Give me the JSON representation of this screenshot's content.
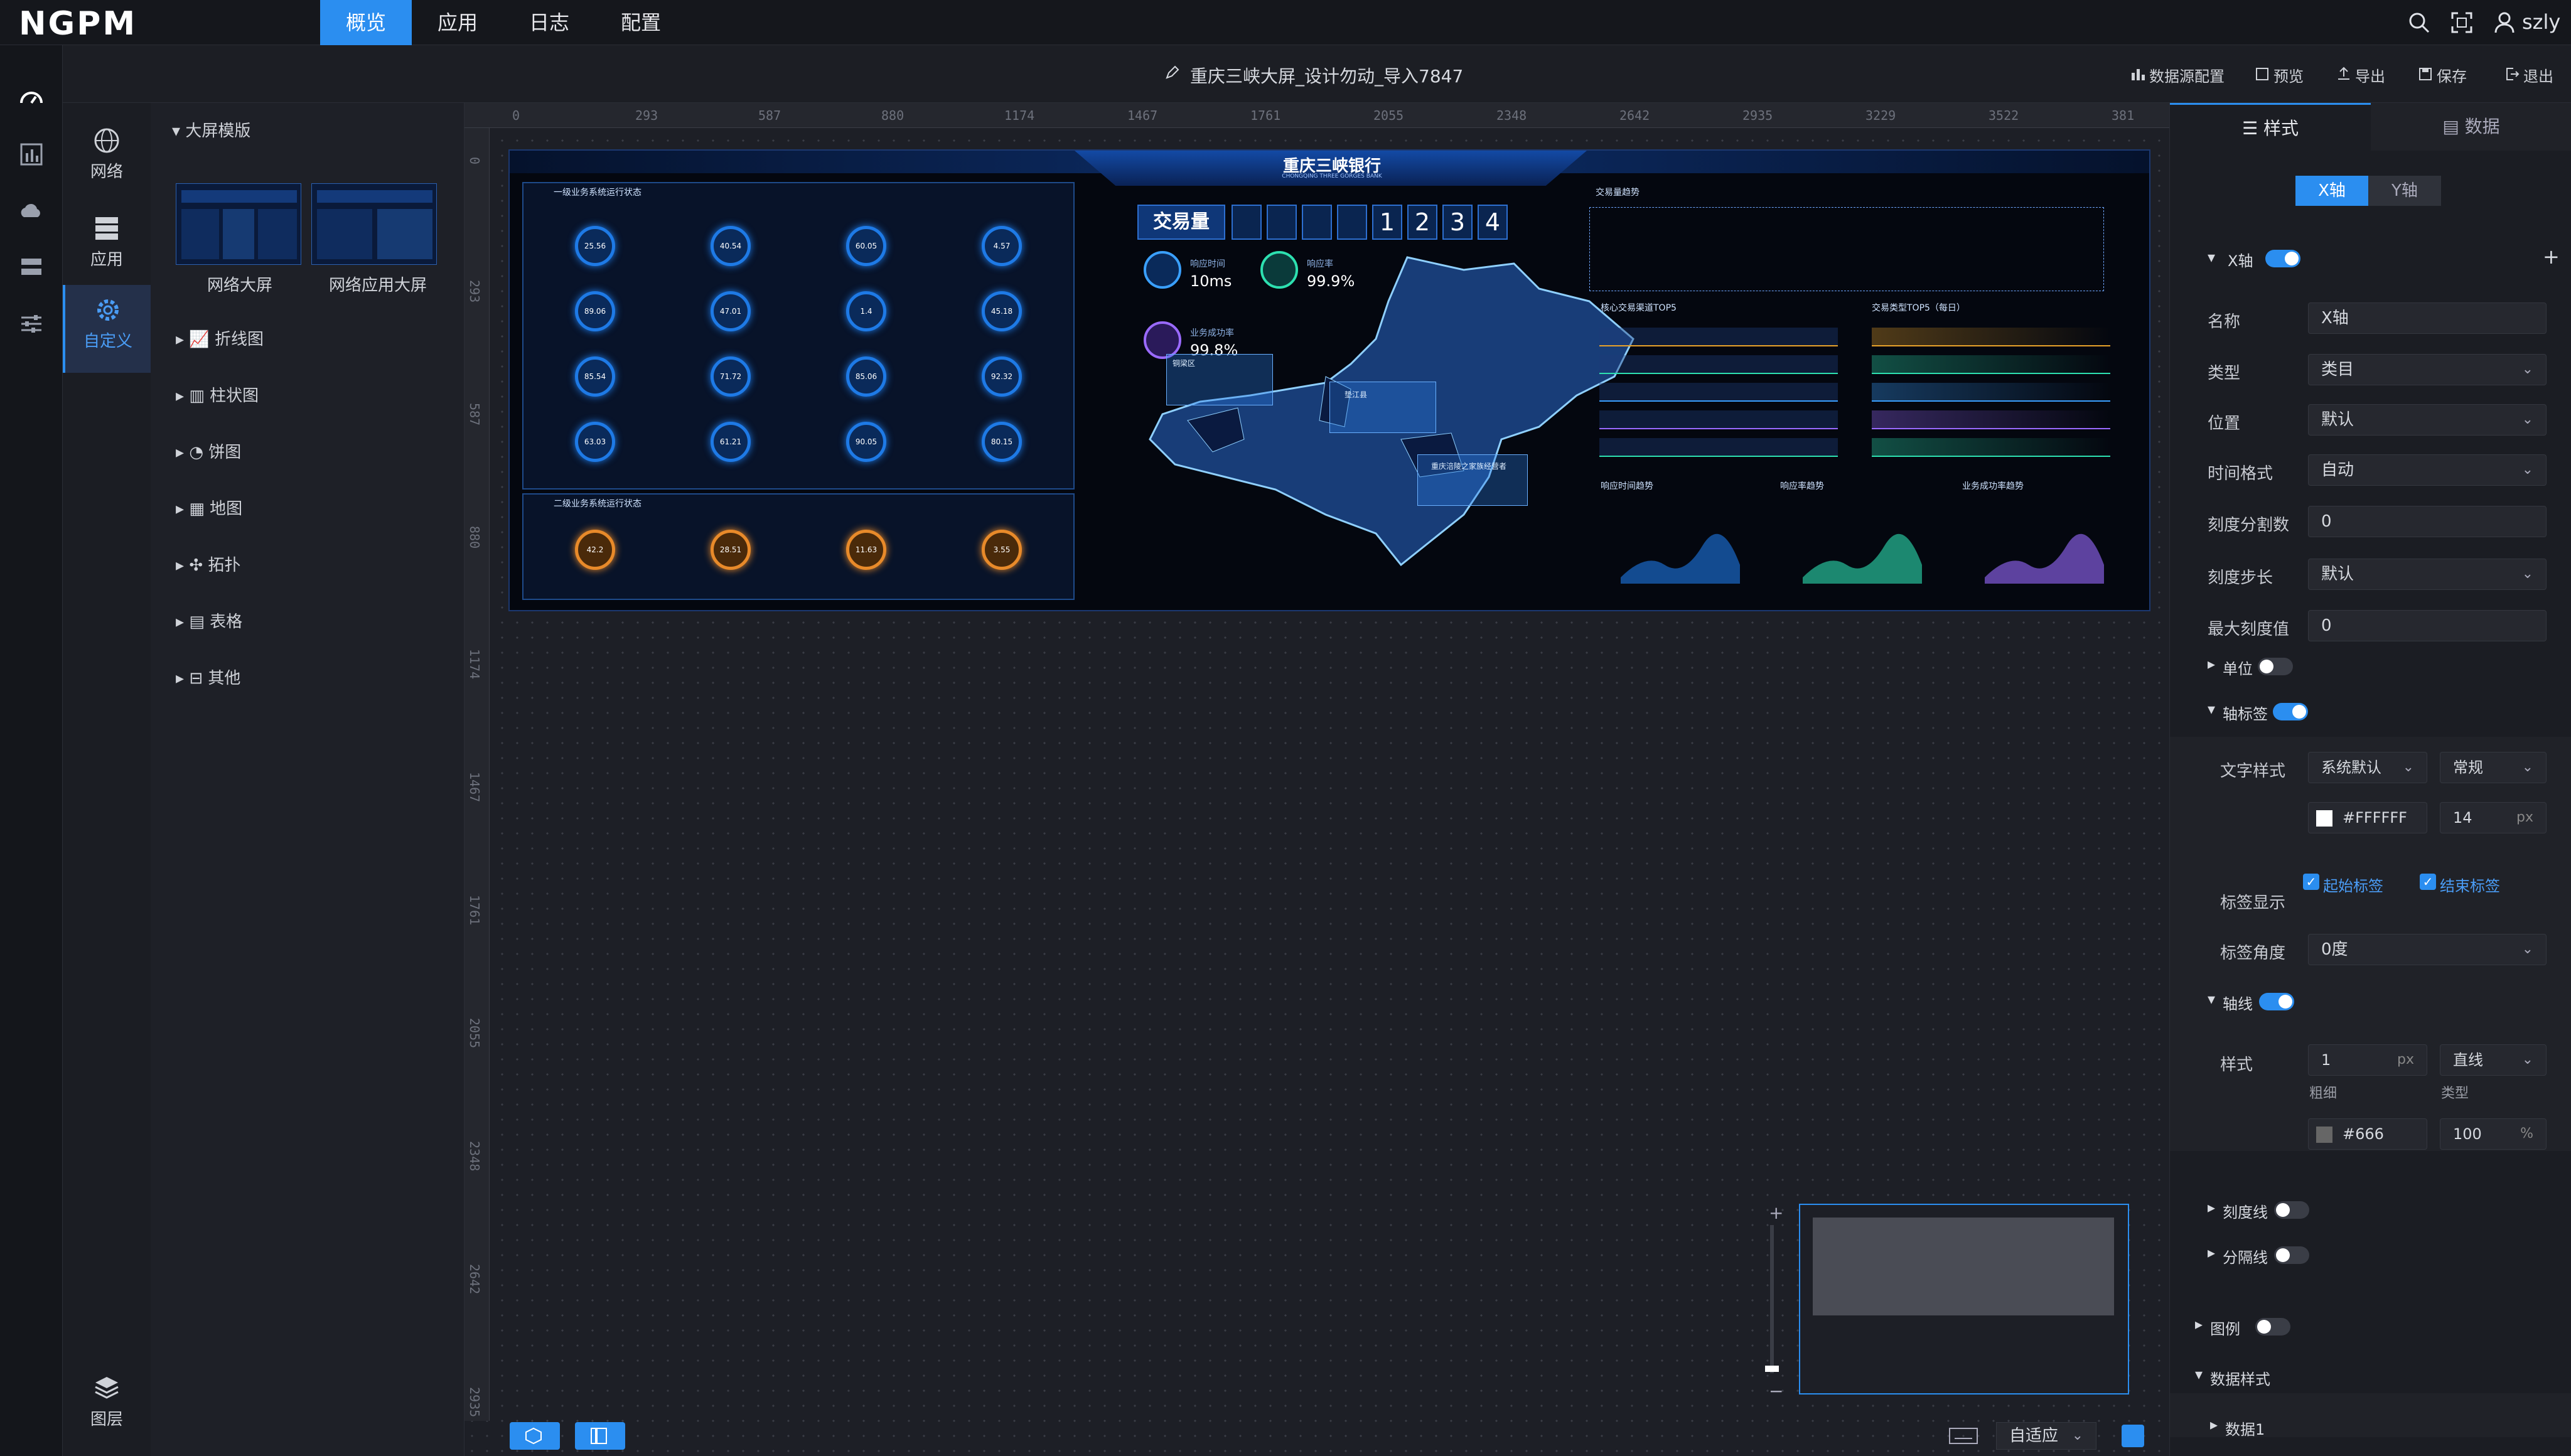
{
  "app": {
    "logo": "NGPM",
    "user": "szly"
  },
  "topnav": [
    {
      "label": "概览",
      "active": true
    },
    {
      "label": "应用"
    },
    {
      "label": "日志"
    },
    {
      "label": "配置"
    }
  ],
  "doc": {
    "title": "重庆三峡大屏_设计勿动_导入7847"
  },
  "toolbar": {
    "datasource": "数据源配置",
    "preview": "预览",
    "export": "导出",
    "save": "保存",
    "exit": "退出"
  },
  "categories": [
    {
      "label": "网络",
      "icon": "globe-icon"
    },
    {
      "label": "应用",
      "icon": "server-icon"
    },
    {
      "label": "自定义",
      "icon": "gear-icon",
      "active": true
    },
    {
      "label": "图层",
      "icon": "layers-icon"
    }
  ],
  "tree": {
    "template_group": "大屏模版",
    "templates": [
      {
        "label": "网络大屏"
      },
      {
        "label": "网络应用大屏"
      }
    ],
    "items": [
      {
        "label": "折线图",
        "icon": "line-chart-icon"
      },
      {
        "label": "柱状图",
        "icon": "bar-chart-icon"
      },
      {
        "label": "饼图",
        "icon": "pie-chart-icon"
      },
      {
        "label": "地图",
        "icon": "map-icon"
      },
      {
        "label": "拓扑",
        "icon": "topology-icon"
      },
      {
        "label": "表格",
        "icon": "table-icon"
      },
      {
        "label": "其他",
        "icon": "other-icon"
      }
    ]
  },
  "ruler": {
    "h": [
      "0",
      "293",
      "587",
      "880",
      "1174",
      "1467",
      "1761",
      "2055",
      "2348",
      "2642",
      "2935",
      "3229",
      "3522",
      "381"
    ],
    "v": [
      "0",
      "293",
      "587",
      "880",
      "1174",
      "1467",
      "1761",
      "2055",
      "2348",
      "2642",
      "2935"
    ]
  },
  "screen": {
    "bank": "重庆三峡银行",
    "bank_en": "CHONGQING THREE GORGES BANK",
    "panel1_title": "一级业务系统运行状态",
    "panel2_title": "二级业务系统运行状态",
    "trade_title": "交易量",
    "trade_digits": [
      "1",
      "2",
      "3",
      "4"
    ],
    "resp_time_label": "响应时间",
    "resp_time": "10ms",
    "resp_rate_label": "响应率",
    "resp_rate": "99.9%",
    "success_label": "业务成功率",
    "success": "99.8%",
    "trend_title": "交易量趋势",
    "top5_channel": "核心交易渠道TOP5",
    "top5_type": "交易类型TOP5（每日）",
    "small_charts": [
      "响应时间趋势",
      "响应率趋势",
      "业务成功率趋势"
    ],
    "map_labels": [
      "铜梁区",
      "垫江县",
      "重庆涪陵之家族经营者"
    ],
    "gauges": [
      "25.56",
      "40.54",
      "60.05",
      "4.57",
      "89.06",
      "47.01",
      "1.4",
      "45.18",
      "85.54",
      "71.72",
      "85.06",
      "92.32",
      "63.03",
      "61.21",
      "90.05",
      "80.15"
    ],
    "gauges2": [
      "42.2",
      "28.51",
      "11.63",
      "3.55"
    ]
  },
  "bottombar": {
    "fit": "自适应"
  },
  "props": {
    "tabs": [
      {
        "label": "样式",
        "active": true
      },
      {
        "label": "数据"
      }
    ],
    "axis_tabs": [
      {
        "label": "X轴",
        "active": true
      },
      {
        "label": "Y轴"
      }
    ],
    "axis_section": "X轴",
    "name_label": "名称",
    "name_value": "X轴",
    "type_label": "类型",
    "type_value": "类目",
    "pos_label": "位置",
    "pos_value": "默认",
    "timefmt_label": "时间格式",
    "timefmt_value": "自动",
    "tickcount_label": "刻度分割数",
    "tickcount_value": "0",
    "tickstep_label": "刻度步长",
    "tickstep_value": "默认",
    "maxtick_label": "最大刻度值",
    "maxtick_value": "0",
    "unit_label": "单位",
    "axislabel_section": "轴标签",
    "textstyle_label": "文字样式",
    "font_value": "系统默认",
    "weight_value": "常规",
    "color_value": "#FFFFFF",
    "size_value": "14",
    "size_unit": "px",
    "labelshow_label": "标签显示",
    "start_label": "起始标签",
    "end_label": "结束标签",
    "angle_label": "标签角度",
    "angle_value": "0度",
    "axisline_section": "轴线",
    "style_label": "样式",
    "line_width": "1",
    "line_width_unit": "px",
    "line_type": "直线",
    "thickness_caption": "粗细",
    "type_caption": "类型",
    "line_color": "#666",
    "opacity": "100",
    "opacity_unit": "%",
    "tickline_section": "刻度线",
    "splitline_section": "分隔线",
    "legend_section": "图例",
    "datastyle_section": "数据样式",
    "data1_section": "数据1"
  }
}
